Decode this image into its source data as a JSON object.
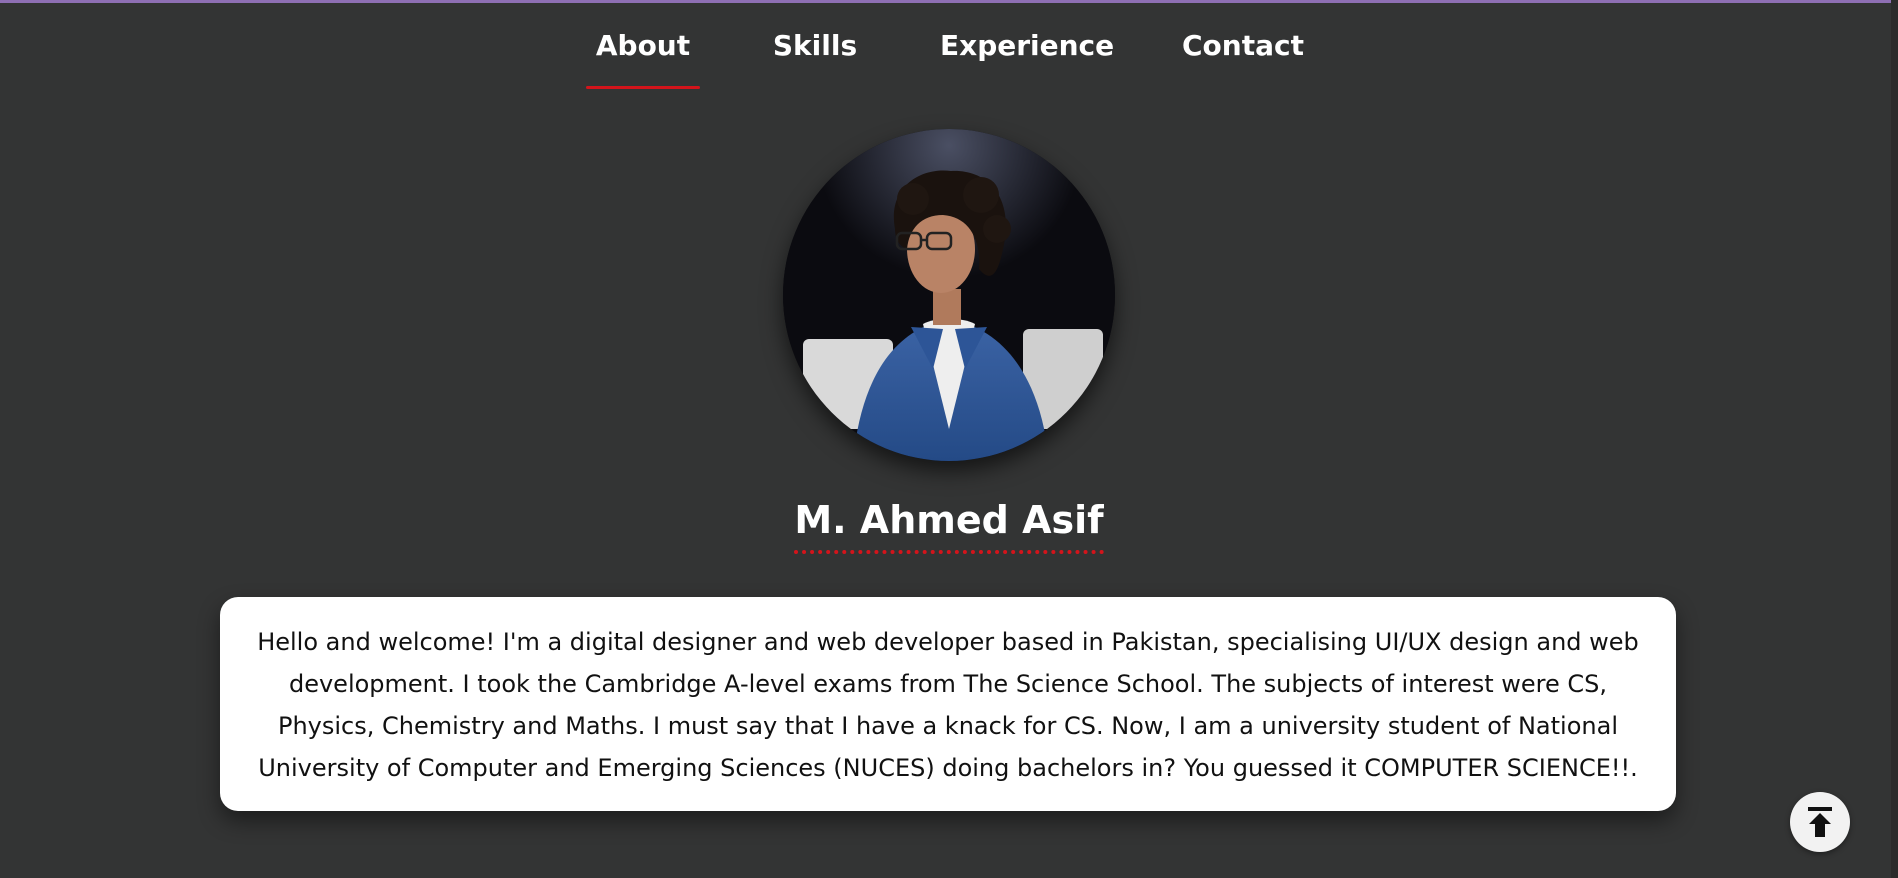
{
  "nav": {
    "items": [
      {
        "label": "About",
        "active": true
      },
      {
        "label": "Skills",
        "active": false
      },
      {
        "label": "Experience",
        "active": false
      },
      {
        "label": "Contact",
        "active": false
      }
    ],
    "accent_color": "#d3141b"
  },
  "profile": {
    "name": "M. Ahmed Asif",
    "bio": "Hello and welcome! I'm a digital designer and web developer based in Pakistan, specialising UI/UX design and web development. I took the Cambridge A-level exams from The Science School. The subjects of interest were CS, Physics, Chemistry and Maths. I must say that I have a knack for CS. Now, I am a university student of National University of Computer and Emerging Sciences (NUCES) doing bachelors in? You guessed it COMPUTER SCIENCE!!."
  },
  "icons": {
    "scroll_top": "arrow-up-to-line-icon"
  },
  "colors": {
    "background": "#333434",
    "top_border": "#8e6fb3",
    "card": "#ffffff"
  }
}
